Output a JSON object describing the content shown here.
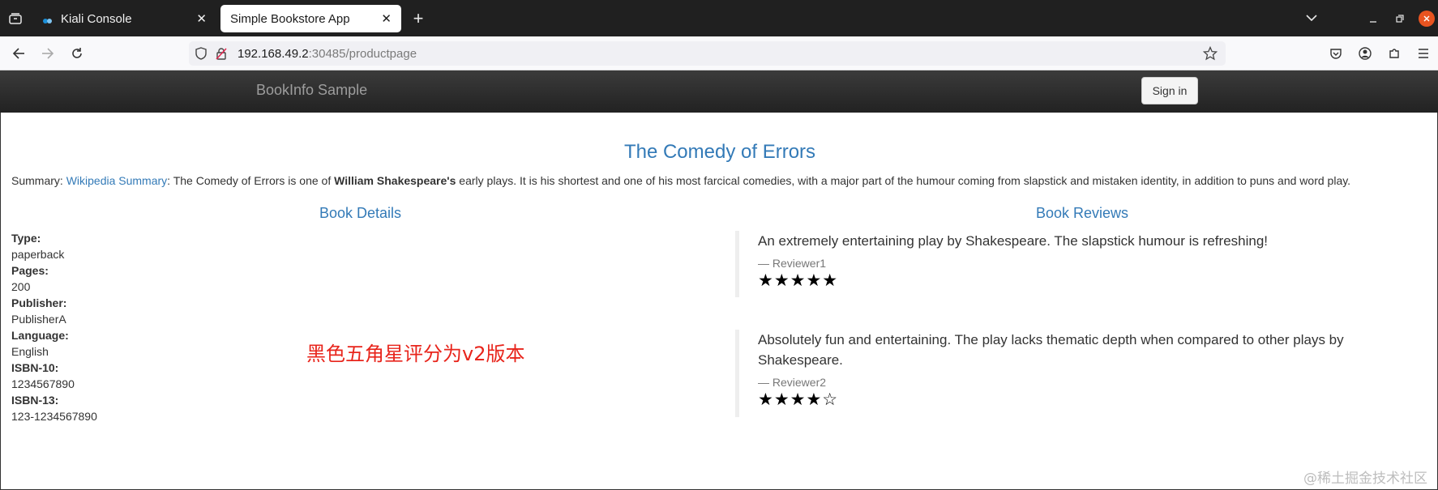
{
  "browser": {
    "tabs": [
      {
        "label": "Kiali Console",
        "close": "✕"
      },
      {
        "label": "Simple Bookstore App",
        "close": "✕"
      }
    ],
    "new_tab": "+",
    "url_host": "192.168.49.2",
    "url_rest": ":30485/productpage"
  },
  "site": {
    "brand": "BookInfo Sample",
    "signin_label": "Sign in"
  },
  "book": {
    "title": "The Comedy of Errors",
    "summary_prefix": "Summary: ",
    "summary_link": "Wikipedia Summary",
    "summary_text_1": ": The Comedy of Errors is one of ",
    "summary_bold": "William Shakespeare's",
    "summary_text_2": " early plays. It is his shortest and one of his most farcical comedies, with a major part of the humour coming from slapstick and mistaken identity, in addition to puns and word play."
  },
  "details": {
    "heading": "Book Details",
    "type_label": "Type:",
    "type_value": "paperback",
    "pages_label": "Pages:",
    "pages_value": "200",
    "publisher_label": "Publisher:",
    "publisher_value": "PublisherA",
    "language_label": "Language:",
    "language_value": "English",
    "isbn10_label": "ISBN-10:",
    "isbn10_value": "1234567890",
    "isbn13_label": "ISBN-13:",
    "isbn13_value": "123-1234567890"
  },
  "reviews": {
    "heading": "Book Reviews",
    "items": [
      {
        "text": "An extremely entertaining play by Shakespeare. The slapstick humour is refreshing!",
        "reviewer": "— Reviewer1",
        "stars": "★★★★★",
        "rating": 5
      },
      {
        "text": "Absolutely fun and entertaining. The play lacks thematic depth when compared to other plays by Shakespeare.",
        "reviewer": "— Reviewer2",
        "stars": "★★★★☆",
        "rating": 4
      }
    ]
  },
  "annotation": "黑色五角星评分为v2版本",
  "watermark": "@稀土掘金技术社区",
  "colors": {
    "link": "#337ab7",
    "annotation": "#e8251c",
    "header": "#222222"
  }
}
